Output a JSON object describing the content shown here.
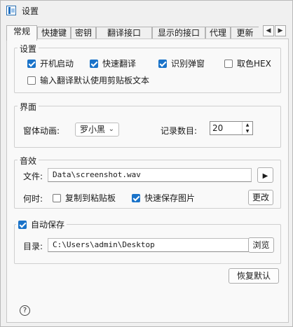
{
  "window": {
    "title": "设置"
  },
  "tabs": [
    "常规",
    "快捷键",
    "密钥",
    "翻译接口",
    "显示的接口",
    "代理",
    "更新"
  ],
  "settings_group": {
    "legend": "设置",
    "items": [
      {
        "label": "开机启动",
        "checked": true
      },
      {
        "label": "快速翻译",
        "checked": true
      },
      {
        "label": "识别弹窗",
        "checked": true
      },
      {
        "label": "取色HEX",
        "checked": false
      },
      {
        "label": "输入翻译默认使用剪贴板文本",
        "checked": false
      }
    ]
  },
  "interface_group": {
    "legend": "界面",
    "animation_label": "窗体动画:",
    "animation_value": "罗小黑",
    "record_label": "记录数目:",
    "record_value": "20"
  },
  "sound_group": {
    "legend": "音效",
    "file_label": "文件:",
    "file_value": "Data\\screenshot.wav",
    "when_label": "何时:",
    "copy_label": "复制到粘贴板",
    "copy_checked": false,
    "save_label": "快速保存图片",
    "save_checked": true,
    "change_label": "更改"
  },
  "autosave_group": {
    "legend": "自动保存",
    "checked": true,
    "dir_label": "目录:",
    "dir_value": "C:\\Users\\admin\\Desktop",
    "browse_label": "浏览"
  },
  "restore_label": "恢复默认",
  "help_label": "?",
  "icons": {
    "play": "play-icon",
    "tab_left": "chevron-left-icon",
    "tab_right": "chevron-right-icon",
    "help": "help-icon"
  },
  "colors": {
    "accent": "#1a73c9"
  }
}
